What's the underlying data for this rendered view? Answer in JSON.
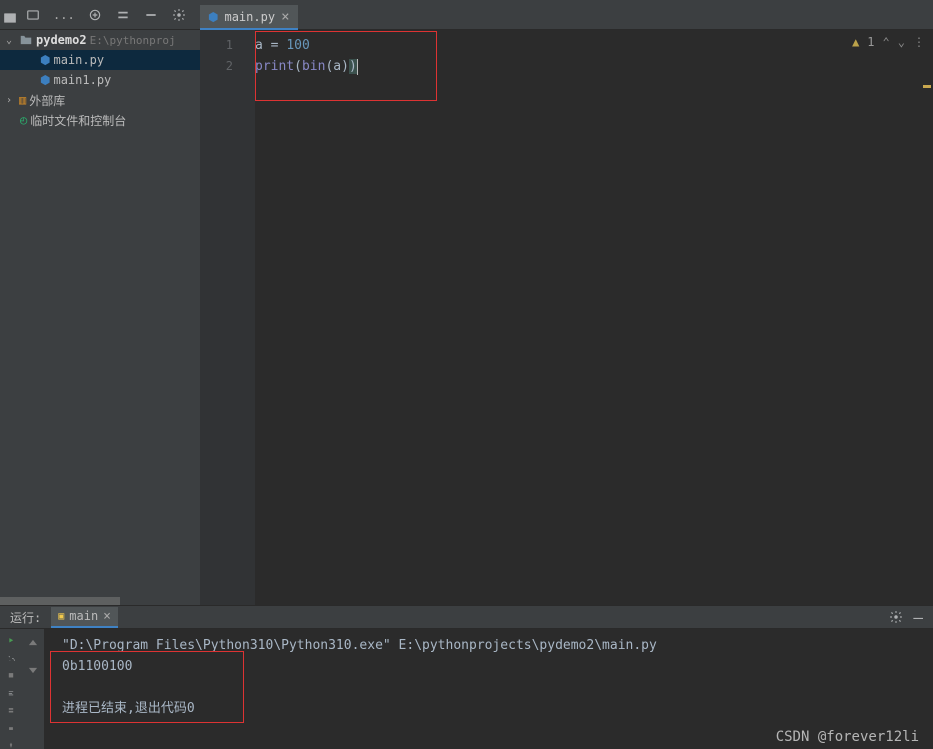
{
  "toolbar": {},
  "tree": {
    "project": "pydemo2",
    "projectPath": "E:\\pythonproj",
    "files": [
      "main.py",
      "main1.py"
    ],
    "extLib": "外部库",
    "scratch": "临时文件和控制台"
  },
  "editor": {
    "tabLabel": "main.py",
    "gutter": [
      "1",
      "2"
    ],
    "code": {
      "l1": {
        "var": "a",
        "op": " = ",
        "num": "100"
      },
      "l2": {
        "fn": "print",
        "p1": "(",
        "bin": "bin",
        "p2": "(",
        "arg": "a",
        "p3": ")",
        "p4": ")"
      }
    },
    "status": {
      "warnCount": "1",
      "up": "⌃",
      "down": "⌄"
    }
  },
  "run": {
    "title": "运行:",
    "tabLabel": "main",
    "lines": {
      "cmd": "\"D:\\Program Files\\Python310\\Python310.exe\" E:\\pythonprojects\\pydemo2\\main.py",
      "out": "0b1100100",
      "end": "进程已结束,退出代码0"
    }
  },
  "watermark": "CSDN @forever12li"
}
